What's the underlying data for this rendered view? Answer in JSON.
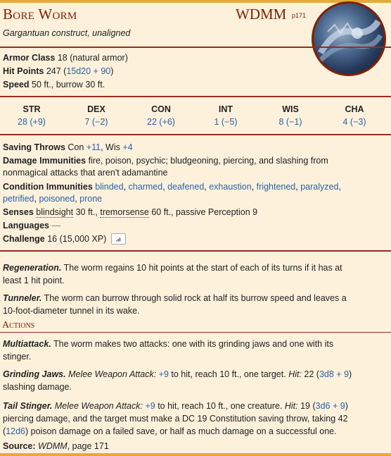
{
  "header": {
    "name": "Bore Worm",
    "source_abbr": "WDMM",
    "source_page": "p171",
    "subtitle": "Gargantuan construct, unaligned"
  },
  "basics": {
    "ac_label": "Armor Class",
    "ac_value": "18 (natural armor)",
    "hp_label": "Hit Points",
    "hp_value": "247",
    "hp_formula": "15d20 + 90",
    "speed_label": "Speed",
    "speed_value": "50 ft., burrow 30 ft."
  },
  "abilities": [
    {
      "label": "STR",
      "value": "28 (+9)"
    },
    {
      "label": "DEX",
      "value": "7 (−2)"
    },
    {
      "label": "CON",
      "value": "22 (+6)"
    },
    {
      "label": "INT",
      "value": "1 (−5)"
    },
    {
      "label": "WIS",
      "value": "8 (−1)"
    },
    {
      "label": "CHA",
      "value": "4 (−3)"
    }
  ],
  "traits": {
    "saves_label": "Saving Throws",
    "saves_con_label": "Con",
    "saves_con": "+11",
    "saves_wis_label": "Wis",
    "saves_wis": "+4",
    "dmg_imm_label": "Damage Immunities",
    "dmg_imm_1": "fire, poison, psychic; bludgeoning, piercing, and slashing from",
    "dmg_imm_2": "nonmagical attacks that aren't adamantine",
    "cond_imm_label": "Condition Immunities",
    "conditions": [
      "blinded",
      "charmed",
      "deafened",
      "exhaustion",
      "frightened",
      "paralyzed",
      "petrified",
      "poisoned",
      "prone"
    ],
    "senses_label": "Senses",
    "senses_blind": "blindsight",
    "senses_blind_range": "30 ft.,",
    "senses_tremor": "tremorsense",
    "senses_rest": "60 ft., passive Perception 9",
    "languages_label": "Languages",
    "languages_value": "—",
    "challenge_label": "Challenge",
    "challenge_value": "16 (15,000 XP)"
  },
  "features": [
    {
      "name": "Regeneration.",
      "text1": "The worm regains 10 hit points at the start of each of its turns if it has at",
      "text2": "least 1 hit point."
    },
    {
      "name": "Tunneler.",
      "text1": "The worm can burrow through solid rock at half its burrow speed and leaves a",
      "text2": "10-foot-diameter tunnel in its wake."
    }
  ],
  "actions_heading": "Actions",
  "actions": {
    "multi_name": "Multiattack.",
    "multi_1": "The worm makes two attacks: one with its grinding jaws and one with its",
    "multi_2": "stinger.",
    "jaws_name": "Grinding Jaws.",
    "jaws_type": "Melee Weapon Attack:",
    "jaws_bonus": "+9",
    "jaws_reach": "to hit, reach 10 ft., one target.",
    "jaws_hit": "Hit:",
    "jaws_dmg": "22 (",
    "jaws_dice": "3d8 + 9",
    "jaws_close": ")",
    "jaws_2": "slashing damage.",
    "tail_name": "Tail Stinger.",
    "tail_type": "Melee Weapon Attack:",
    "tail_bonus": "+9",
    "tail_reach": "to hit, reach 10 ft., one creature.",
    "tail_hit": "Hit:",
    "tail_dmg": "19 (",
    "tail_dice": "3d6 + 9",
    "tail_close": ")",
    "tail_2": "piercing damage, and the target must make a DC 19 Constitution saving throw, taking 42",
    "tail_3_open": "(",
    "tail_3_dice": "12d6",
    "tail_3_rest": ") poison damage on a failed save, or half as much damage on a successful one."
  },
  "source": {
    "label": "Source:",
    "book": "WDMM",
    "page": ", page 171"
  },
  "colors": {
    "accent": "#822000",
    "rule": "#9c2b1b",
    "link": "#2a62a8",
    "background": "#fdf1dc",
    "bar": "#e6a93a"
  }
}
